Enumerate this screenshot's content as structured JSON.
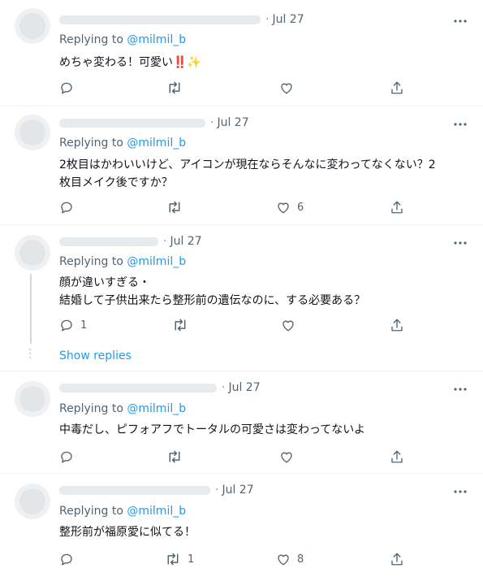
{
  "tweets": [
    {
      "date": "Jul 27",
      "replying_label": "Replying to ",
      "replying_handle": "@milmil_b",
      "text_lines": [
        "めちゃ変わる！可愛い‼️✨"
      ],
      "reply_count": "",
      "retweet_count": "",
      "like_count": ""
    },
    {
      "date": "Jul 27",
      "replying_label": "Replying to ",
      "replying_handle": "@milmil_b",
      "text_lines": [
        "2枚目はかわいいけど、アイコンが現在ならそんなに変わってなくない？2",
        "枚目メイク後ですか？"
      ],
      "reply_count": "",
      "retweet_count": "",
      "like_count": "6"
    },
    {
      "date": "Jul 27",
      "replying_label": "Replying to ",
      "replying_handle": "@milmil_b",
      "text_lines": [
        "顔が違いすぎる・",
        "結婚して子供出来たら整形前の遺伝なのに、する必要ある？"
      ],
      "reply_count": "1",
      "retweet_count": "",
      "like_count": "",
      "show_replies": "Show replies"
    },
    {
      "date": "Jul 27",
      "replying_label": "Replying to ",
      "replying_handle": "@milmil_b",
      "text_lines": [
        "中毒だし、ピフォアフでトータルの可愛さは変わってないよ"
      ],
      "reply_count": "",
      "retweet_count": "",
      "like_count": ""
    },
    {
      "date": "Jul 27",
      "replying_label": "Replying to ",
      "replying_handle": "@milmil_b",
      "text_lines": [
        "整形前が福原愛に似てる！"
      ],
      "reply_count": "",
      "retweet_count": "1",
      "like_count": "8"
    }
  ],
  "icons": [
    "more-icon",
    "reply-icon",
    "retweet-icon",
    "like-icon",
    "share-icon"
  ],
  "colors": {
    "link": "#1d9bf0",
    "secondary": "#536471",
    "text": "#0f1419",
    "border": "#eff3f4"
  }
}
